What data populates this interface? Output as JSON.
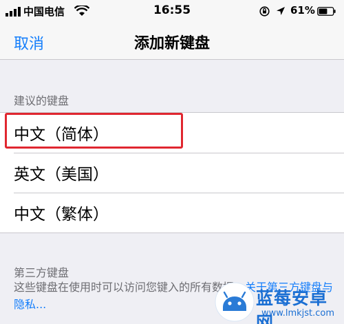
{
  "status_bar": {
    "carrier": "中国电信",
    "time": "16:55",
    "battery_percent": "61%",
    "battery_level": 0.61
  },
  "nav": {
    "cancel_label": "取消",
    "title": "添加新键盘"
  },
  "suggested": {
    "header": "建议的键盘",
    "items": [
      {
        "label": "中文（简体）"
      },
      {
        "label": "英文（美国）"
      },
      {
        "label": "中文（繁体）"
      }
    ]
  },
  "third_party": {
    "header": "第三方键盘",
    "description": "这些键盘在使用时可以访问您键入的所有数据。",
    "link_text": "关于第三方键盘与隐私..."
  },
  "watermark": {
    "title": "蓝莓安卓网",
    "url": "www.lmkjst.com"
  },
  "colors": {
    "accent": "#147efb",
    "highlight": "#e0262f",
    "background": "#efeff4"
  }
}
